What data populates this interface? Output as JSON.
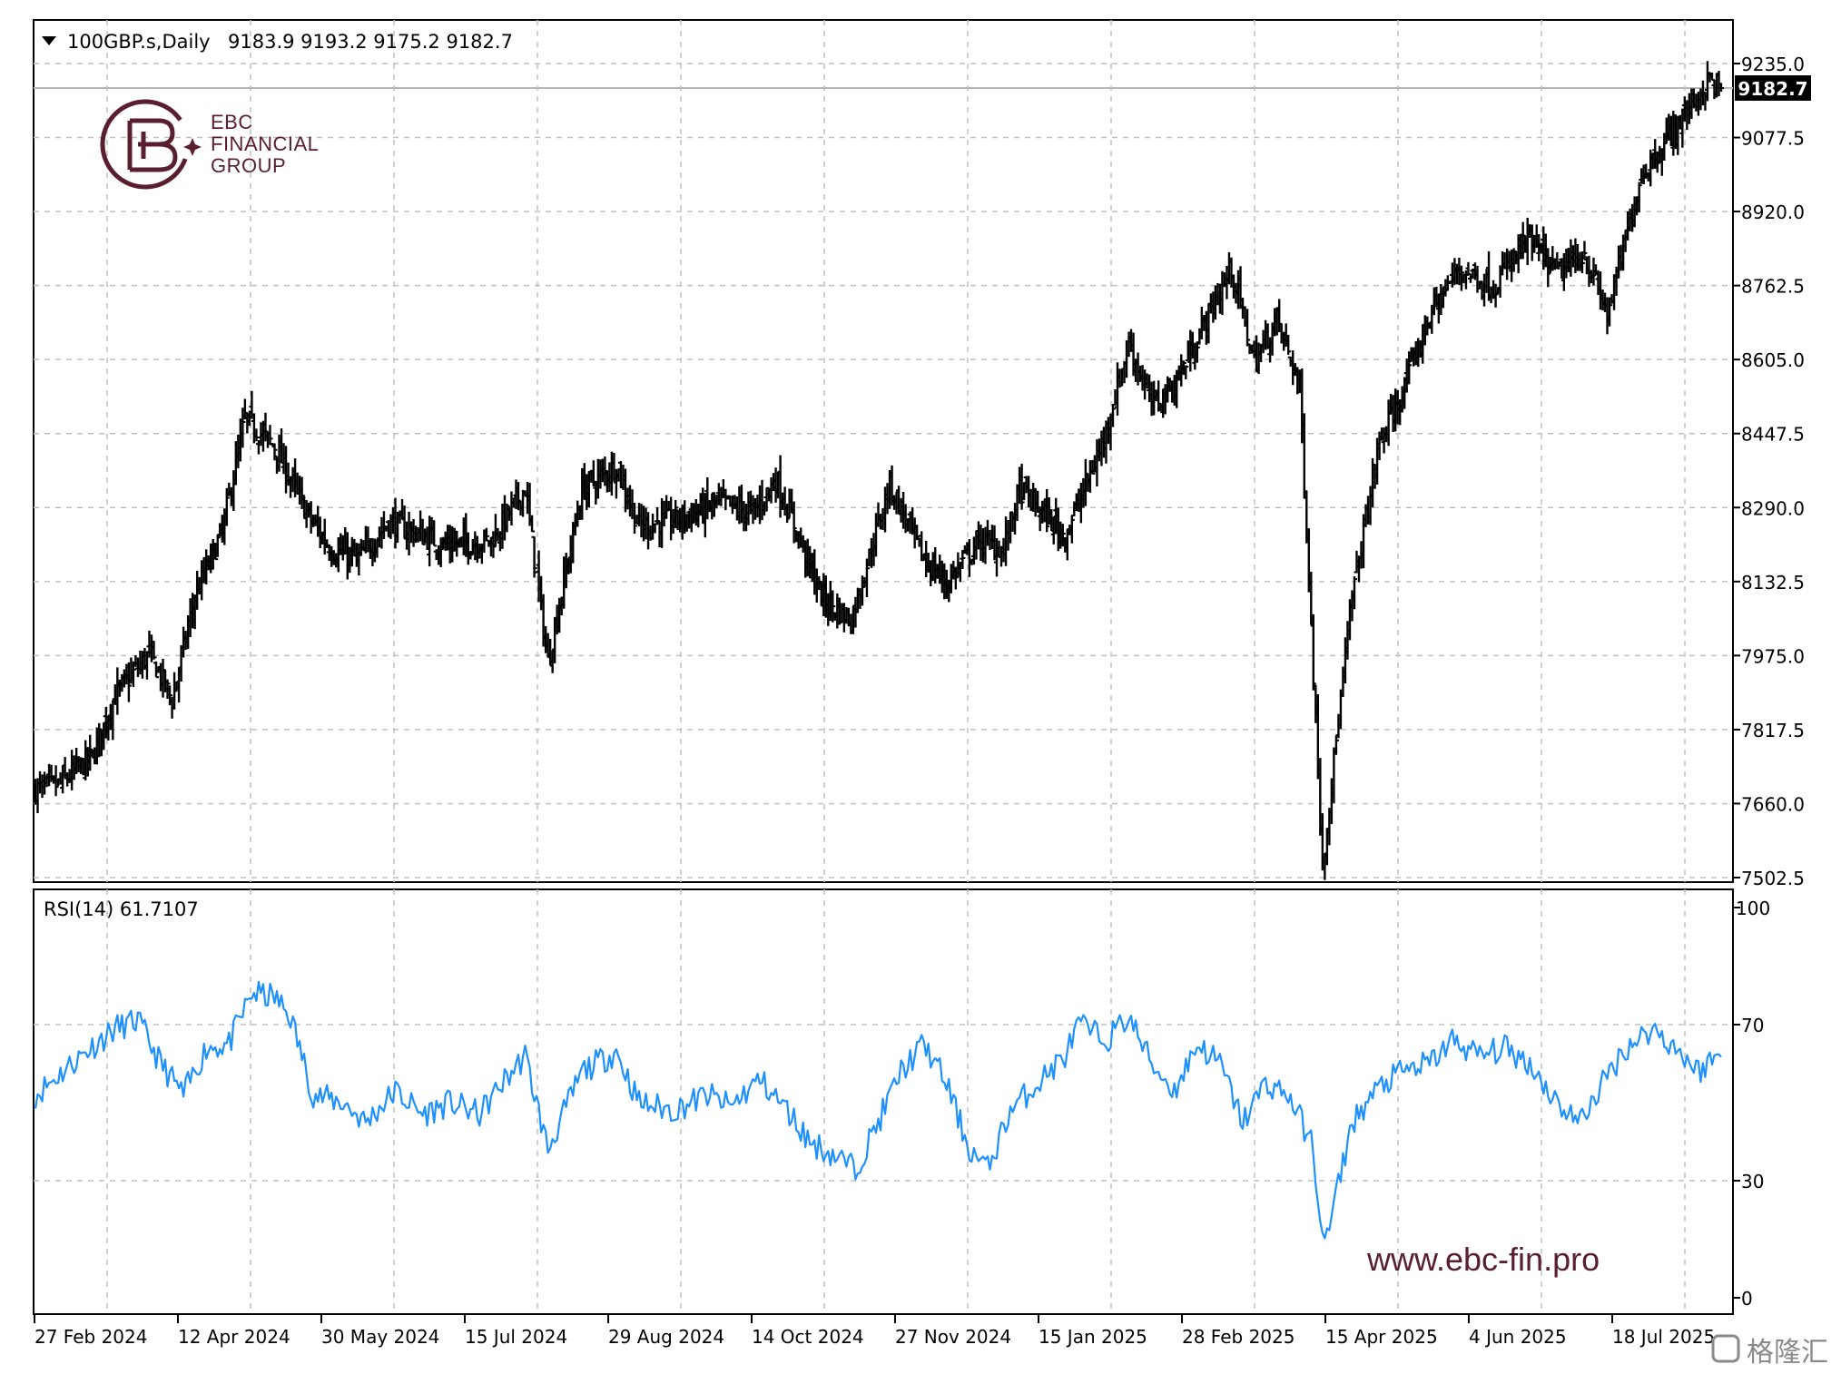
{
  "header": {
    "symbol": "100GBP.s,Daily",
    "ohlc": "9183.9 9193.2 9175.2 9182.7"
  },
  "price_label": "9182.7",
  "rsi_header": "RSI(14) 61.7107",
  "logo": {
    "line1": "EBC",
    "line2": "FINANCIAL",
    "line3": "GROUP"
  },
  "website": "www.ebc-fin.pro",
  "watermark": "格隆汇",
  "colors": {
    "bars": "#000000",
    "rsi": "#1e90ff",
    "grid": "#c0c0c0",
    "brand": "#5a1f2e"
  },
  "chart_data": [
    {
      "type": "ohlc",
      "title": "100GBP.s,Daily",
      "y_ticks": [
        "9235.0",
        "9077.5",
        "8920.0",
        "8762.5",
        "8605.0",
        "8447.5",
        "8290.0",
        "8132.5",
        "7975.0",
        "7817.5",
        "7660.0",
        "7502.5"
      ],
      "ylim": [
        7502.5,
        9235.0
      ],
      "x_ticks": [
        "27 Feb 2024",
        "12 Apr 2024",
        "30 May 2024",
        "15 Jul 2024",
        "29 Aug 2024",
        "14 Oct 2024",
        "27 Nov 2024",
        "15 Jan 2025",
        "28 Feb 2025",
        "15 Apr 2025",
        "4 Jun 2025",
        "18 Jul 2025"
      ],
      "last": {
        "open": 9183.9,
        "high": 9193.2,
        "low": 9175.2,
        "close": 9182.7
      },
      "close_path": [
        [
          0,
          7690
        ],
        [
          10,
          7700
        ],
        [
          25,
          7760
        ],
        [
          35,
          7890
        ],
        [
          50,
          7980
        ],
        [
          60,
          7880
        ],
        [
          70,
          8100
        ],
        [
          82,
          8240
        ],
        [
          92,
          8480
        ],
        [
          105,
          8420
        ],
        [
          120,
          8270
        ],
        [
          130,
          8200
        ],
        [
          142,
          8180
        ],
        [
          155,
          8260
        ],
        [
          165,
          8240
        ],
        [
          180,
          8210
        ],
        [
          200,
          8220
        ],
        [
          215,
          8330
        ],
        [
          225,
          7960
        ],
        [
          240,
          8330
        ],
        [
          255,
          8380
        ],
        [
          265,
          8250
        ],
        [
          285,
          8270
        ],
        [
          300,
          8300
        ],
        [
          315,
          8280
        ],
        [
          325,
          8350
        ],
        [
          335,
          8230
        ],
        [
          345,
          8100
        ],
        [
          358,
          8050
        ],
        [
          375,
          8340
        ],
        [
          390,
          8180
        ],
        [
          400,
          8130
        ],
        [
          415,
          8220
        ],
        [
          425,
          8200
        ],
        [
          432,
          8330
        ],
        [
          452,
          8230
        ],
        [
          468,
          8420
        ],
        [
          480,
          8640
        ],
        [
          490,
          8510
        ],
        [
          500,
          8550
        ],
        [
          515,
          8700
        ],
        [
          525,
          8800
        ],
        [
          535,
          8600
        ],
        [
          545,
          8690
        ],
        [
          555,
          8550
        ],
        [
          565,
          7530
        ],
        [
          578,
          8100
        ],
        [
          590,
          8430
        ],
        [
          600,
          8530
        ],
        [
          612,
          8700
        ],
        [
          625,
          8800
        ],
        [
          640,
          8760
        ],
        [
          655,
          8860
        ],
        [
          668,
          8790
        ],
        [
          680,
          8830
        ],
        [
          690,
          8700
        ],
        [
          705,
          9000
        ],
        [
          720,
          9100
        ],
        [
          735,
          9200
        ],
        [
          740,
          9182.7
        ]
      ]
    },
    {
      "type": "line",
      "title": "RSI(14) 61.7107",
      "y_ticks": [
        "100",
        "70",
        "30",
        "0"
      ],
      "ylim": [
        0,
        100
      ],
      "last_value": 61.7107,
      "rsi_path": [
        [
          0,
          52
        ],
        [
          10,
          57
        ],
        [
          22,
          63
        ],
        [
          35,
          69
        ],
        [
          45,
          71
        ],
        [
          55,
          60
        ],
        [
          65,
          52
        ],
        [
          75,
          64
        ],
        [
          85,
          65
        ],
        [
          95,
          78
        ],
        [
          105,
          77
        ],
        [
          112,
          72
        ],
        [
          122,
          52
        ],
        [
          135,
          50
        ],
        [
          145,
          45
        ],
        [
          158,
          53
        ],
        [
          170,
          47
        ],
        [
          182,
          50
        ],
        [
          195,
          47
        ],
        [
          205,
          55
        ],
        [
          215,
          62
        ],
        [
          225,
          38
        ],
        [
          240,
          58
        ],
        [
          255,
          63
        ],
        [
          265,
          50
        ],
        [
          280,
          48
        ],
        [
          295,
          52
        ],
        [
          305,
          49
        ],
        [
          318,
          56
        ],
        [
          330,
          48
        ],
        [
          340,
          40
        ],
        [
          352,
          36
        ],
        [
          360,
          33
        ],
        [
          370,
          45
        ],
        [
          380,
          58
        ],
        [
          390,
          65
        ],
        [
          400,
          55
        ],
        [
          410,
          38
        ],
        [
          418,
          33
        ],
        [
          428,
          48
        ],
        [
          440,
          55
        ],
        [
          452,
          62
        ],
        [
          458,
          70
        ],
        [
          470,
          66
        ],
        [
          480,
          72
        ],
        [
          490,
          60
        ],
        [
          500,
          53
        ],
        [
          510,
          65
        ],
        [
          520,
          60
        ],
        [
          530,
          45
        ],
        [
          540,
          55
        ],
        [
          550,
          52
        ],
        [
          560,
          40
        ],
        [
          566,
          13
        ],
        [
          578,
          45
        ],
        [
          590,
          54
        ],
        [
          600,
          58
        ],
        [
          612,
          60
        ],
        [
          622,
          66
        ],
        [
          634,
          62
        ],
        [
          645,
          64
        ],
        [
          656,
          60
        ],
        [
          668,
          50
        ],
        [
          678,
          45
        ],
        [
          688,
          55
        ],
        [
          698,
          64
        ],
        [
          710,
          69
        ],
        [
          720,
          64
        ],
        [
          730,
          58
        ],
        [
          738,
          62
        ],
        [
          740,
          61.7107
        ]
      ]
    }
  ]
}
